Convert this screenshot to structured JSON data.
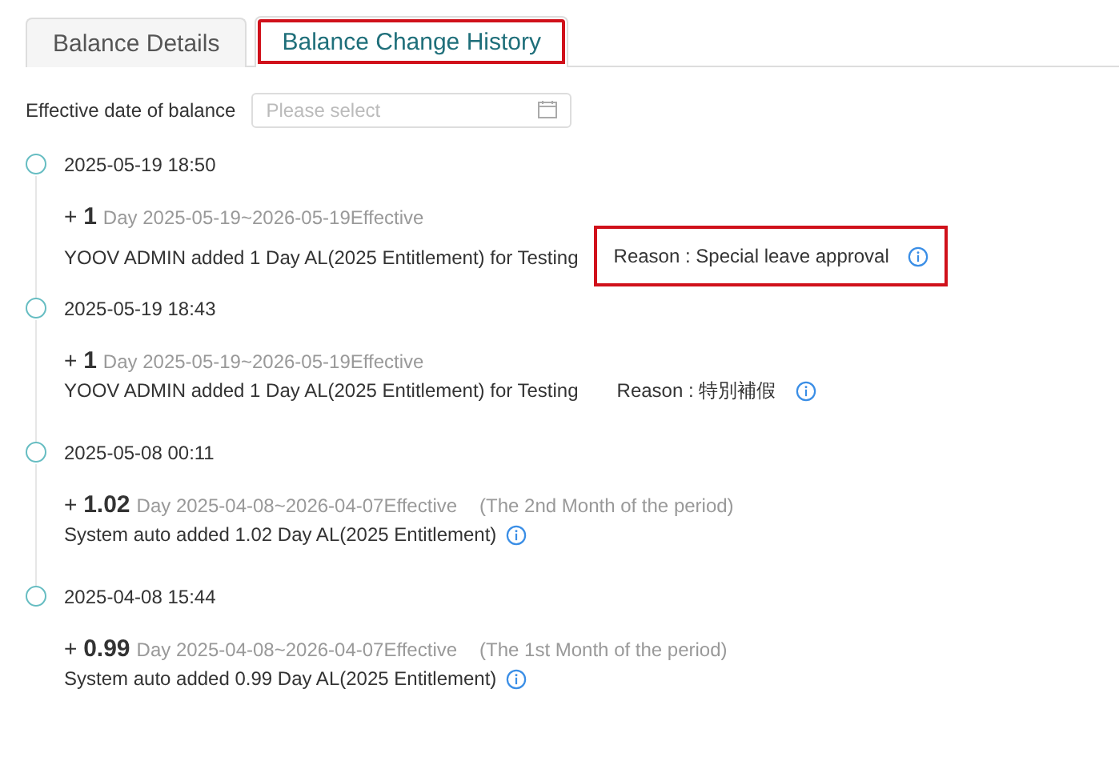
{
  "tabs": [
    {
      "label": "Balance Details",
      "selected": false,
      "highlighted": false
    },
    {
      "label": "Balance Change History",
      "selected": true,
      "highlighted": true
    }
  ],
  "filter": {
    "label": "Effective date of balance",
    "placeholder": "Please select"
  },
  "entries": [
    {
      "time": "2025-05-19 18:50",
      "sign": "+",
      "amount": "1",
      "period": "Day 2025-05-19~2026-05-19Effective",
      "description": "YOOV ADMIN added 1 Day AL(2025 Entitlement) for Testing",
      "reason": "Reason : Special leave approval",
      "highlighted": true
    },
    {
      "time": "2025-05-19 18:43",
      "sign": "+",
      "amount": "1",
      "period": "Day 2025-05-19~2026-05-19Effective",
      "description": "YOOV ADMIN added 1 Day AL(2025 Entitlement) for Testing",
      "reason": "Reason : 特別補假",
      "highlighted": false
    },
    {
      "time": "2025-05-08 00:11",
      "sign": "+",
      "amount": "1.02",
      "period": "Day 2025-04-08~2026-04-07Effective",
      "note": "(The 2nd Month of the period)",
      "description": "System auto added 1.02 Day AL(2025 Entitlement)"
    },
    {
      "time": "2025-04-08 15:44",
      "sign": "+",
      "amount": "0.99",
      "period": "Day 2025-04-08~2026-04-07Effective",
      "note": "(The 1st Month of the period)",
      "description": "System auto added 0.99 Day AL(2025 Entitlement)"
    }
  ]
}
